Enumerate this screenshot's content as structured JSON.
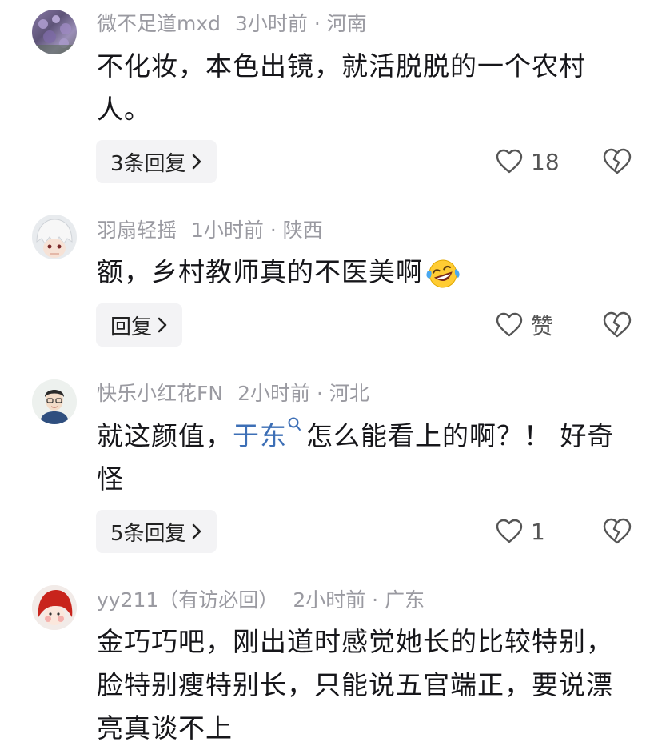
{
  "comments": [
    {
      "username": "微不足道mxd",
      "time": "3小时前",
      "location": "河南",
      "text": "不化妆，本色出镜，就活脱脱的一个农村人。",
      "reply_label": "3条回复",
      "likes": "18",
      "avatar": "purple-flower-avatar"
    },
    {
      "username": "羽扇轻摇",
      "time": "1小时前",
      "location": "陕西",
      "text": "额，乡村教师真的不医美啊",
      "emoji": "crying-laughing-emoji",
      "reply_label": "回复",
      "likes": "赞",
      "avatar": "white-hair-anime-avatar"
    },
    {
      "username": "快乐小红花FN",
      "time": "2小时前",
      "location": "河北",
      "text_before": "就这颜值，",
      "mention": "于东",
      "text_after": "怎么能看上的啊？！ 好奇怪",
      "reply_label": "5条回复",
      "likes": "1",
      "avatar": "cartoon-man-avatar"
    },
    {
      "username": "yy211（有访必回）",
      "time": "2小时前",
      "location": "广东",
      "text": "金巧巧吧，刚出道时感觉她长的比较特别，脸特别瘦特别长，只能说五官端正，要说漂亮真谈不上",
      "avatar": "red-hood-girl-avatar"
    }
  ],
  "separator": "·"
}
